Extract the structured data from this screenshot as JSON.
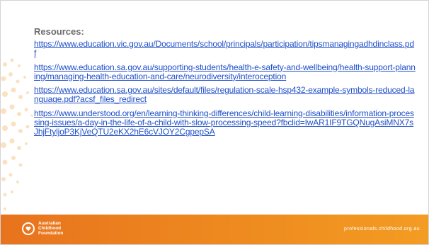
{
  "slide": {
    "heading": "Resources:",
    "links": [
      "https://www.education.vic.gov.au/Documents/school/principals/participation/tipsmanagingadhdinclass.pdf",
      "https://www.education.sa.gov.au/supporting-students/health-e-safety-and-wellbeing/health-support-planning/managing-health-education-and-care/neurodiversity/interoception",
      "https://www.education.sa.gov.au/sites/default/files/regulation-scale-hsp432-example-symbols-reduced-language.pdf?acsf_files_redirect",
      "https://www.understood.org/en/learning-thinking-differences/child-learning-disabilities/information-processing-issues/a-day-in-the-life-of-a-child-with-slow-processing-speed?fbclid=IwAR1IF9TGQNugAsiMNX7sJhjFtyljoP3KjVeQTU2eKX2hE6cVJOY2CgpepSA"
    ]
  },
  "footer": {
    "logo_lines": [
      "Australian",
      "Childhood",
      "Foundation"
    ],
    "url": "professionals.childhood.org.au",
    "color_start": "#e8731e",
    "color_end": "#f39c22"
  },
  "colors": {
    "link": "#1f4fc8",
    "heading": "#6b6b6b",
    "decor_dots": "#f2b566"
  }
}
